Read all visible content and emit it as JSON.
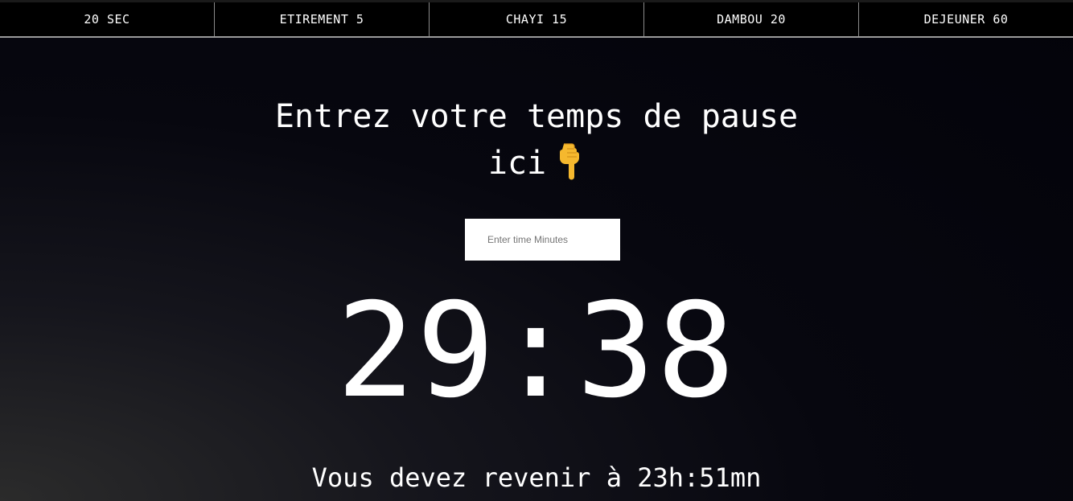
{
  "nav": {
    "items": [
      {
        "label": "20 SEC"
      },
      {
        "label": "ETIREMENT 5"
      },
      {
        "label": "CHAYI 15"
      },
      {
        "label": "DAMBOU 20"
      },
      {
        "label": "DEJEUNER 60"
      }
    ]
  },
  "heading": {
    "line1": "Entrez votre temps de pause",
    "line2": "ici",
    "icon": "pointing-down-hand-icon"
  },
  "time_input": {
    "value": "",
    "placeholder": "Enter time Minutes"
  },
  "timer": {
    "display": "29:38"
  },
  "return_message": "Vous devez revenir à 23h:51mn",
  "colors": {
    "background": "#03030a",
    "text": "#ffffff",
    "icon_yellow": "#f5b82e"
  }
}
